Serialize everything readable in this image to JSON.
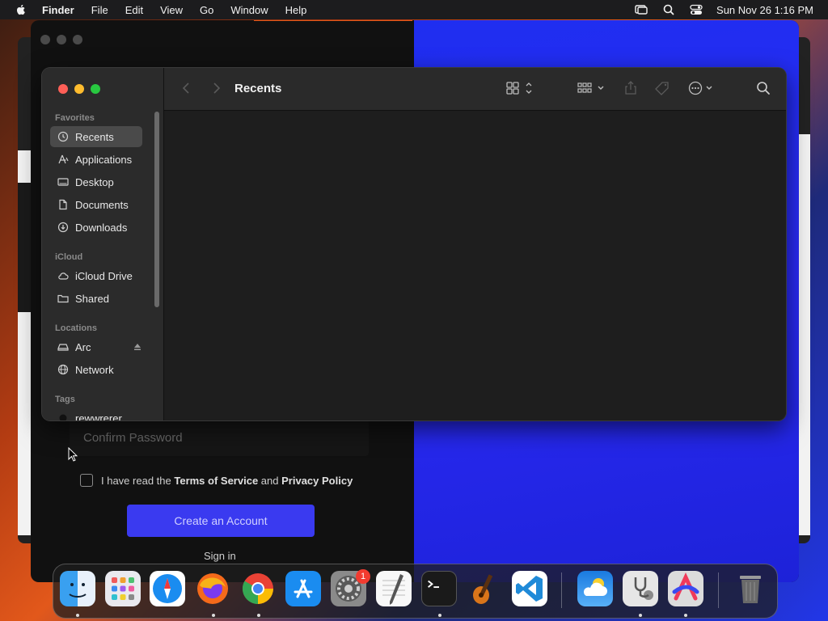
{
  "menubar": {
    "app": "Finder",
    "items": [
      "File",
      "Edit",
      "View",
      "Go",
      "Window",
      "Help"
    ],
    "clock": "Sun Nov 26  1:16 PM"
  },
  "finder": {
    "title": "Recents",
    "sidebar": {
      "favorites_label": "Favorites",
      "favorites": [
        "Recents",
        "Applications",
        "Desktop",
        "Documents",
        "Downloads"
      ],
      "icloud_label": "iCloud",
      "icloud": [
        "iCloud Drive",
        "Shared"
      ],
      "locations_label": "Locations",
      "locations": [
        "Arc",
        "Network"
      ],
      "tags_label": "Tags",
      "tags": [
        "rewwrerer"
      ]
    }
  },
  "web_form": {
    "confirm_password_placeholder": "Confirm Password",
    "terms_prefix": "I have read the",
    "terms_link": "Terms of Service",
    "terms_and": "and",
    "privacy_link": "Privacy Policy",
    "create_button": "Create an Account",
    "signin_link": "Sign in"
  },
  "dock": {
    "apps": [
      "finder-icon",
      "launchpad-icon",
      "safari-icon",
      "firefox-icon",
      "chrome-icon",
      "app-store-icon",
      "system-settings-icon",
      "textedit-icon",
      "terminal-icon",
      "garageband-icon",
      "vscode-icon",
      "weather-icon",
      "disk-utility-icon",
      "arc-icon",
      "trash-icon"
    ],
    "settings_badge": "1"
  },
  "colors": {
    "accent_blue": "#3a3af0",
    "traffic_red": "#fe5f57",
    "traffic_yellow": "#febc2e",
    "traffic_green": "#28c840"
  }
}
